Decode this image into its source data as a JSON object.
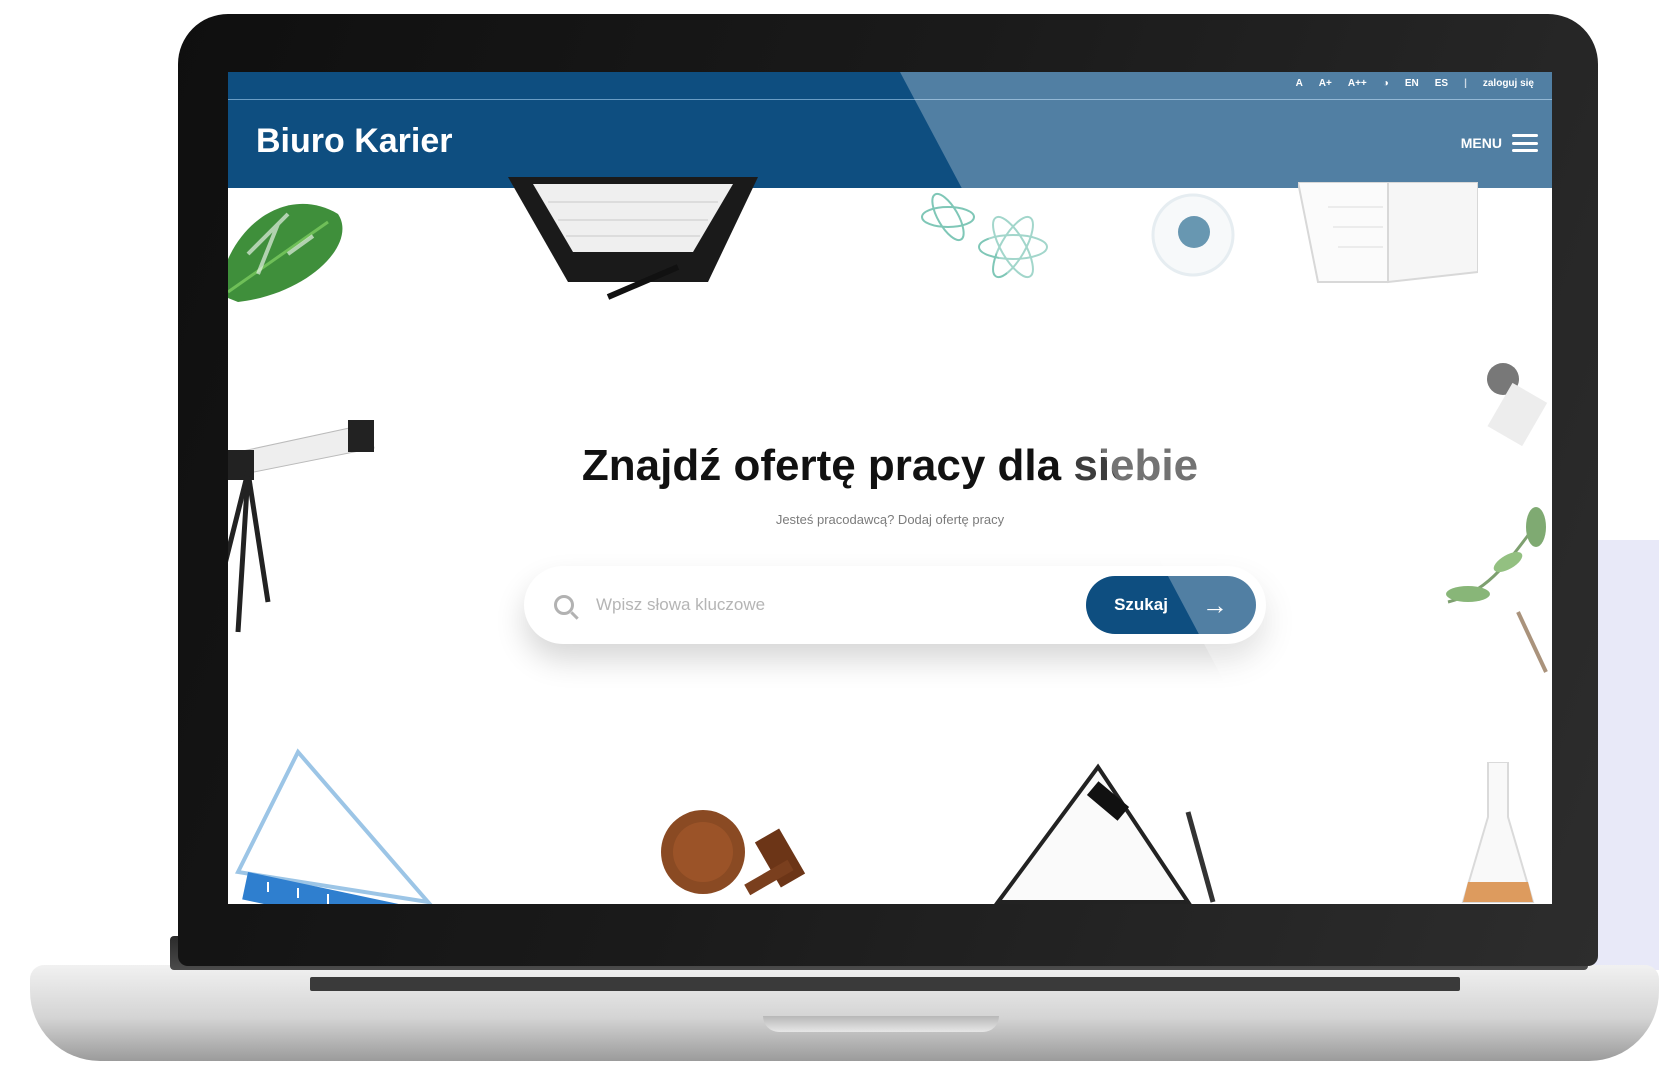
{
  "header": {
    "utility_items": [
      "A",
      "A+",
      "A++",
      "◑",
      "EN",
      "ES"
    ],
    "login_label": "zaloguj się",
    "brand": "Biuro Karier",
    "menu_label": "MENU"
  },
  "hero": {
    "title_main": "Znajdź ofertę pracy dla",
    "title_accent": "siebie",
    "subtitle": "Jesteś pracodawcą? Dodaj ofertę pracy"
  },
  "search": {
    "placeholder": "Wpisz słowa kluczowe",
    "button_label": "Szukaj",
    "button_arrow": "→"
  },
  "colors": {
    "brand_blue": "#0e4e80",
    "device_gray": "#1a1a1a",
    "panel_lavender": "#e8e9f8"
  },
  "icons": [
    "search-icon",
    "hamburger-menu-icon",
    "arrow-right-icon",
    "contrast-icon"
  ]
}
